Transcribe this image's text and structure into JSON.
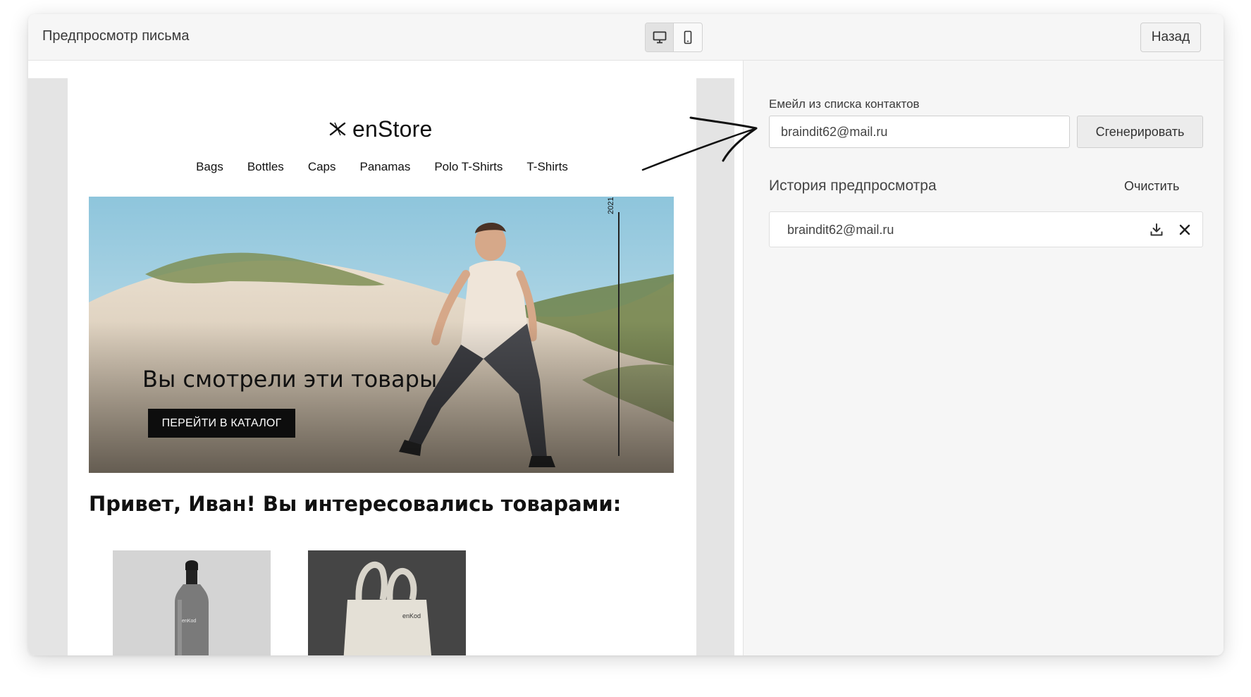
{
  "header": {
    "title": "Предпросмотр письма",
    "back_label": "Назад",
    "device_toggle": {
      "desktop_icon": "monitor-icon",
      "mobile_icon": "phone-icon",
      "active": "desktop"
    }
  },
  "email_preview": {
    "brand": "enStore",
    "brand_icon": "enstore-logo-icon",
    "nav_items": [
      "Bags",
      "Bottles",
      "Caps",
      "Panamas",
      "Polo T-Shirts",
      "T-Shirts"
    ],
    "hero": {
      "year": "2021",
      "title": "Вы смотрели эти товары",
      "button_label": "ПЕРЕЙТИ В КАТАЛОГ"
    },
    "greeting": "Привет, Иван! Вы интересовались товарами:",
    "products": [
      {
        "name": "bottle",
        "brand_mark": "enKod"
      },
      {
        "name": "tote-bag",
        "brand_mark": "enKod"
      }
    ]
  },
  "sidebar": {
    "email_label": "Емейл из списка контактов",
    "email_value": "braindit62@mail.ru",
    "generate_label": "Сгенерировать",
    "history_title": "История предпросмотра",
    "clear_label": "Очистить",
    "history": [
      {
        "email": "braindit62@mail.ru",
        "actions": [
          "download-icon",
          "close-icon"
        ]
      }
    ]
  }
}
